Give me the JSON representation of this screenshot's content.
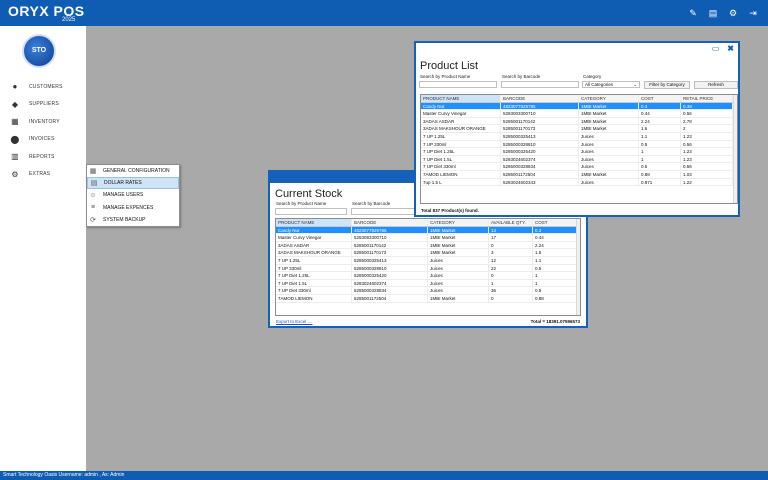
{
  "header": {
    "brand": "ORYX POS",
    "year": "2025",
    "icons": [
      "pen-icon",
      "file-icon",
      "user-settings-icon",
      "logout-icon"
    ]
  },
  "sidebar": {
    "logo_text": "STO",
    "items": [
      {
        "label": "CUSTOMERS",
        "icon": "person-icon"
      },
      {
        "label": "SUPPLIERS",
        "icon": "suppliers-icon"
      },
      {
        "label": "INVENTORY",
        "icon": "inventory-icon"
      },
      {
        "label": "INVOICES",
        "icon": "invoice-icon"
      },
      {
        "label": "REPORTS",
        "icon": "chart-icon"
      },
      {
        "label": "EXTRAS",
        "icon": "gear-icon"
      }
    ]
  },
  "extras_menu": {
    "items": [
      {
        "label": "GENERAL CONFIGURATION",
        "icon": "config-icon"
      },
      {
        "label": "DOLLAR RATES",
        "icon": "dollar-icon"
      },
      {
        "label": "MANAGE USERS",
        "icon": "users-icon"
      },
      {
        "label": "MANAGE EXPENCES",
        "icon": "expense-icon"
      },
      {
        "label": "SYSTEM BACKUP",
        "icon": "backup-icon"
      }
    ]
  },
  "current_stock": {
    "title": "Current Stock",
    "search_name_label": "Search by Product Name",
    "search_barcode_label": "Search by Barcode",
    "columns": [
      "PRODUCT NAME",
      "BARCODE",
      "CATEGORY",
      "AVAILABLE QTY.",
      "COST"
    ],
    "rows": [
      [
        "Candy Nut",
        "4823077929785",
        "1MBI Market",
        "13",
        "0.3"
      ],
      [
        "Master Curvy Vinegar",
        "5283083300710",
        "1MBI Market",
        "17",
        "0.44"
      ],
      [
        "3ADAS ASDAR",
        "5285001170142",
        "1MBI Market",
        "0",
        "2.24"
      ],
      [
        "3ADAS MAKSHOUR ORANGE",
        "5285001170173",
        "1MBI Market",
        "3",
        "1.6"
      ],
      [
        "7 UP 1.25L",
        "5285000325413",
        "Juices",
        "12",
        "1.1"
      ],
      [
        "7 UP 330ml",
        "5285000328810",
        "Juices",
        "22",
        "0.5"
      ],
      [
        "7 UP Diet 1.25L",
        "5285000325420",
        "Juices",
        "0",
        "1"
      ],
      [
        "7 UP Diet 1.5L",
        "5283024602374",
        "Juices",
        "1",
        "1"
      ],
      [
        "7 UP Diet 330ml",
        "5285000328834",
        "Juices",
        "36",
        "0.5"
      ],
      [
        "7AMOD LIEMON",
        "5285001172504",
        "1MBI Market",
        "0",
        "0.88"
      ]
    ],
    "export_link": "Export to Excel ....",
    "total": "Total = 18391.07596573"
  },
  "product_list": {
    "title": "Product List",
    "search_name_label": "Search by Product Name",
    "search_barcode_label": "Search by Barcode",
    "category_label": "Category",
    "category_value": "All Categories",
    "filter_button": "Filter by Category",
    "refresh_button": "Refresh",
    "columns": [
      "PRODUCT NAME",
      "BARCODE",
      "CATEGORY",
      "COST",
      "RETAIL PRICE"
    ],
    "rows": [
      [
        "Candy Nut",
        "4823077929785",
        "1MBI Market",
        "0.3",
        "0.39"
      ],
      [
        "Master Curvy Vinegar",
        "5283003300710",
        "1MBI Market",
        "0.44",
        "0.56"
      ],
      [
        "3ADAS ASDAR",
        "5285001170142",
        "1MBI Market",
        "2.24",
        "2.78"
      ],
      [
        "3ADAS MAKSHOUR ORANGE",
        "5285001170173",
        "1MBI Market",
        "1.6",
        "2"
      ],
      [
        "7 UP 1.25L",
        "5285000325413",
        "Juices",
        "1.1",
        "1.23"
      ],
      [
        "7 UP 330ml",
        "5285000328810",
        "Juices",
        "0.5",
        "0.56"
      ],
      [
        "7 UP Diet 1.25L",
        "5285000325420",
        "Juices",
        "1",
        "1.23"
      ],
      [
        "7 UP Diet 1.5L",
        "5283024602374",
        "Juices",
        "1",
        "1.23"
      ],
      [
        "7 UP Diet 330ml",
        "5285000328834",
        "Juices",
        "0.5",
        "0.56"
      ],
      [
        "7AMOD LIEMON",
        "5285001172504",
        "1MBI Market",
        "0.88",
        "1.03"
      ],
      [
        "7up 1.5 L",
        "5283024602343",
        "Juices",
        "0.971",
        "1.22"
      ]
    ],
    "total": "Total 837 Product(s) found."
  },
  "status_bar": {
    "text": "Smart Technology Oasis     Username: admin , As: Admin"
  }
}
